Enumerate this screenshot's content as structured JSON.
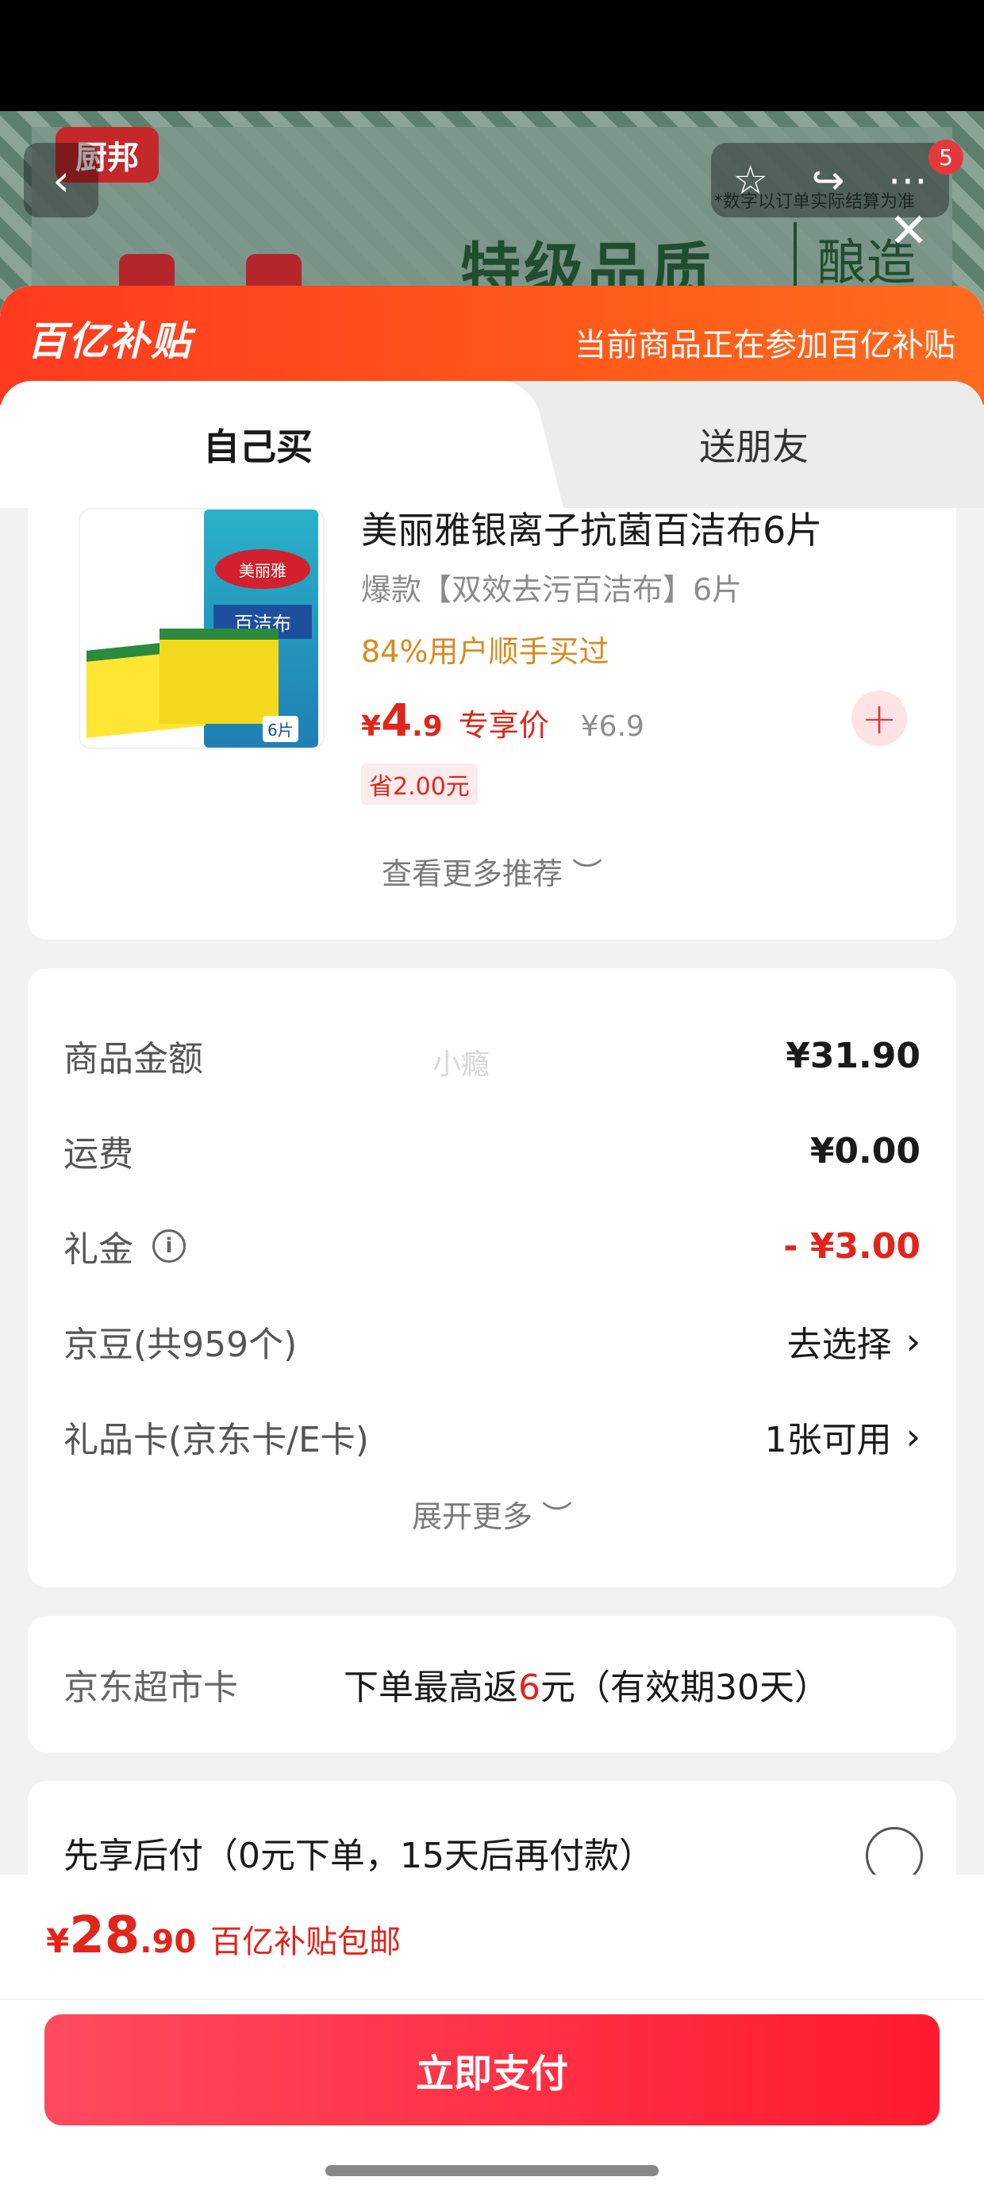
{
  "background": {
    "brand_logo": "厨邦",
    "tagline": "特级品质",
    "tagline_2": "酿造",
    "note": "*数字以订单实际结算为准",
    "cart_badge": "5"
  },
  "subsidy_bar": {
    "logo": "百亿补贴",
    "text": "当前商品正在参加百亿补贴"
  },
  "tabs": [
    {
      "label": "自己买",
      "active": true
    },
    {
      "label": "送朋友",
      "active": false
    }
  ],
  "product": {
    "image_brand": "美丽雅",
    "image_label": "百洁布",
    "image_tag": "6片",
    "title": "美丽雅银离子抗菌百洁布6片",
    "subtitle": "爆款【双效去污百洁布】6片",
    "rate": "84%用户顺手买过",
    "price_yen": "¥",
    "price_int": "4",
    "price_dec": ".9",
    "price_tag": "专享价",
    "original_price": "¥6.9",
    "save_tag": "省2.00元",
    "add_icon": "plus-icon"
  },
  "more_reco": "查看更多推荐 ︶",
  "summary": {
    "watermark": "小瘾",
    "rows": [
      {
        "label": "商品金额",
        "value": "¥31.90"
      },
      {
        "label": "运费",
        "value": "¥0.00"
      },
      {
        "label": "礼金",
        "value": "- ¥3.00"
      },
      {
        "label": "京豆(共959个)",
        "value": "去选择"
      },
      {
        "label": "礼品卡(京东卡/E卡)",
        "value": "1张可用"
      }
    ],
    "expand": "展开更多 ︶"
  },
  "market_card": {
    "label": "京东超市卡",
    "text_before": "下单最高返",
    "highlight": "6",
    "text_after": "元（有效期30天）"
  },
  "paylater": {
    "text": "先享后付（0元下单，15天后再付款）"
  },
  "footer": {
    "price_yen": "¥",
    "price_int": "28",
    "price_dec": ".90",
    "price_tag": "百亿补贴包邮",
    "pay_label": "立即支付"
  },
  "colors": {
    "accent_red": "#e1251b",
    "subsidy_orange": "#ff4a1f",
    "pay_button": "#ff2a3c"
  }
}
